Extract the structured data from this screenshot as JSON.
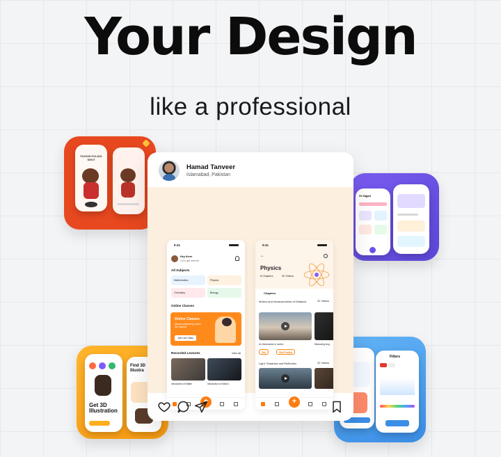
{
  "hero": {
    "headline": "Your Design",
    "subline": "like a professional"
  },
  "post": {
    "author_name": "Hamad Tanveer",
    "author_location": "Islamabad, Pakistan",
    "actions": [
      "heart-icon",
      "comment-icon",
      "share-icon",
      "bookmark-icon"
    ]
  },
  "home_screen": {
    "time": "9:41",
    "greeting": "Hey there",
    "greeting_sub": "Let's get started",
    "all_subjects_heading": "All Subjects",
    "subjects": [
      "Mathematics",
      "Physics",
      "Chemistry",
      "Biology"
    ],
    "online_heading": "Online Classes",
    "online_card_title": "Online Classes",
    "online_card_desc": "Attend subjects by online live classes",
    "online_card_button": "Join Live Class",
    "recorded_heading": "Recorded Lectures",
    "view_all": "View all",
    "lecture_captions": [
      "Introduction of Matter",
      "Introduction of Motion"
    ]
  },
  "physics_screen": {
    "time": "9:41",
    "title": "Physics",
    "chapters_count": "8 Chapters",
    "videos_count": "32 Videos",
    "chapters_heading": "Chapters",
    "chapter1_title": "Motion and measurements of Distance",
    "chapter1_videos": "32 Videos",
    "video1_caption": "An Introduction to motion",
    "video2_caption": "Measuring leng",
    "chip_test": "Test",
    "chip_practice": "Start Practice",
    "chapter2_title": "Light, Shadows and Reflection",
    "chapter2_videos": "32 Videos"
  },
  "tiles": {
    "orange_phone_text": "FUCKIN POLSIO SHOT",
    "yellow_title": "Get 3D Illustration",
    "yellow_title2": "Find 3D Illustra",
    "purple_greeting": "Hi Sajjad",
    "blue_title": "Filters"
  },
  "colors": {
    "accent_orange": "#ff7b0f",
    "card_bg": "#fcefdf",
    "tile_orange": "#e8481f",
    "tile_purple": "#6a52e6",
    "tile_yellow": "#ffa91f",
    "tile_blue": "#4fa0ef"
  }
}
